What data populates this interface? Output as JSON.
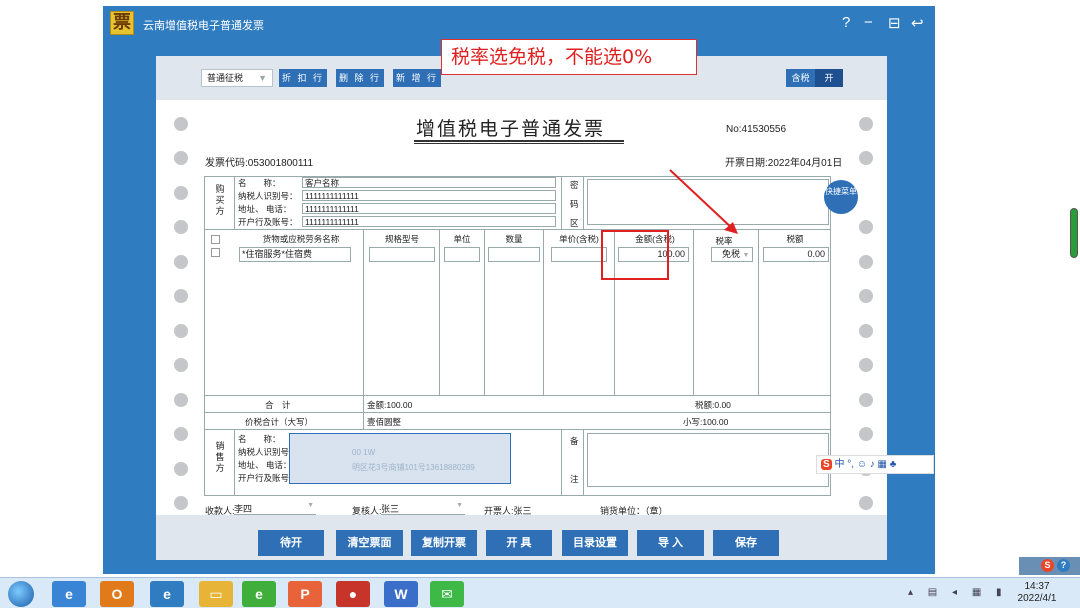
{
  "window": {
    "logo_char": "票",
    "title": "云南增值税电子普通发票",
    "controls": [
      "?",
      "−",
      "⊟",
      "↩"
    ]
  },
  "toolbar": {
    "invoice_type": "普通征税",
    "buttons": [
      "折 扣 行",
      "删 除 行",
      "新 增 行"
    ],
    "tax_incl_label": "含税",
    "tax_incl_value": "开"
  },
  "invoice": {
    "title": "增值税电子普通发票",
    "no": "No:41530556",
    "code": "发票代码:053001800111",
    "date": "开票日期:2022年04月01日",
    "buyer": {
      "side_label": "购买方",
      "fields": [
        {
          "label": "名　　称：",
          "value": "客户名称"
        },
        {
          "label": "纳税人识别号：",
          "value": "1111111111111"
        },
        {
          "label": "地址、 电话：",
          "value": "1111111111111"
        },
        {
          "label": "开户行及账号：",
          "value": "1111111111111"
        }
      ],
      "secret_labels": [
        "密",
        "码",
        "区"
      ]
    },
    "columns": [
      "货物或应税劳务名称",
      "规格型号",
      "单位",
      "数量",
      "单价(含税)",
      "金额(含税)",
      "税率",
      "税额"
    ],
    "item": {
      "name": "*住宿服务*住宿费",
      "amount": "100.00",
      "rate": "免税",
      "tax": "0.00"
    },
    "total_label": "合　计",
    "total_amount": "金额:100.00",
    "total_tax": "税额:0.00",
    "sum_label": "价税合计（大写）",
    "sum_upper": "壹佰圆整",
    "sum_lower": "小写:100.00",
    "seller": {
      "side_label": "销售方",
      "fields": [
        {
          "label": "名　　称："
        },
        {
          "label": "纳税人识别号："
        },
        {
          "label": "地址、 电话："
        },
        {
          "label": "开户行及账号："
        }
      ],
      "masked_text": [
        "00 1W",
        "明区花3号商铺101号13618880289"
      ],
      "remark_labels": [
        "备",
        "注"
      ]
    },
    "payee_label": "收款人:",
    "payee": "李四",
    "reviewer_label": "复核人:",
    "reviewer": "张三",
    "drawer": "开票人:张三",
    "seller_unit": "销货单位：（章）"
  },
  "annotation": {
    "note": "税率选免税，不能选0%"
  },
  "quick_menu": "快捷菜单",
  "actions": [
    "待开",
    "清空票面",
    "复制开票",
    "开 具",
    "目录设置",
    "导 入",
    "保存"
  ],
  "ime": {
    "label": "中"
  },
  "taskbar": {
    "time": "14:37",
    "date": "2022/4/1"
  },
  "colors": {
    "accent": "#2f7cc1",
    "button": "#2e6fb6",
    "alert": "#e02020"
  }
}
